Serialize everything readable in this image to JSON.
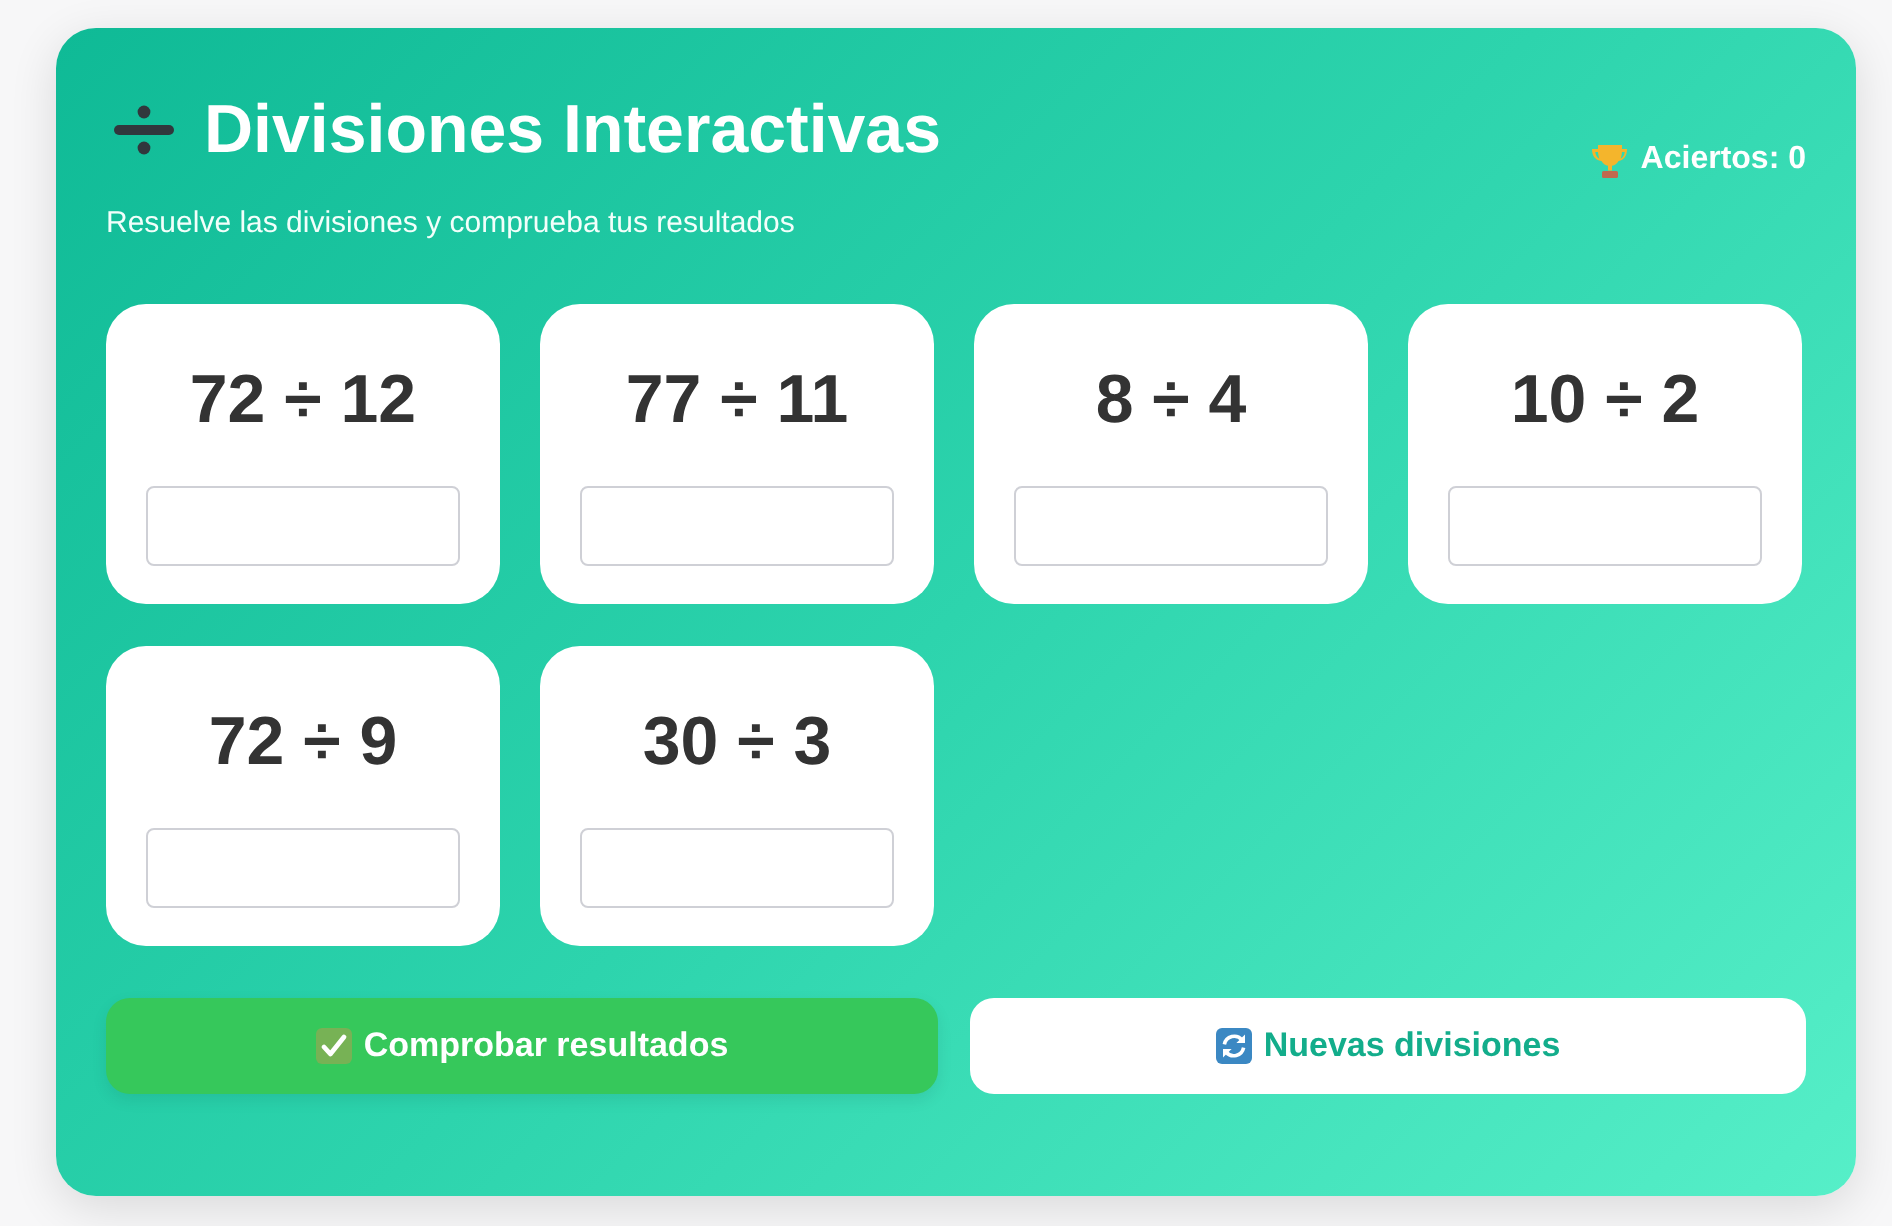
{
  "header": {
    "title": "Divisiones Interactivas",
    "subtitle": "Resuelve las divisiones y comprueba tus resultados",
    "score": "Aciertos: 0"
  },
  "problems": [
    {
      "expression": "72 ÷ 12"
    },
    {
      "expression": "77 ÷ 11"
    },
    {
      "expression": "8 ÷ 4"
    },
    {
      "expression": "10 ÷ 2"
    },
    {
      "expression": "72 ÷ 9"
    },
    {
      "expression": "30 ÷ 3"
    }
  ],
  "buttons": [
    {
      "label": "Comprobar resultados",
      "kind": "check"
    },
    {
      "label": "Nuevas divisiones",
      "kind": "new"
    }
  ]
}
